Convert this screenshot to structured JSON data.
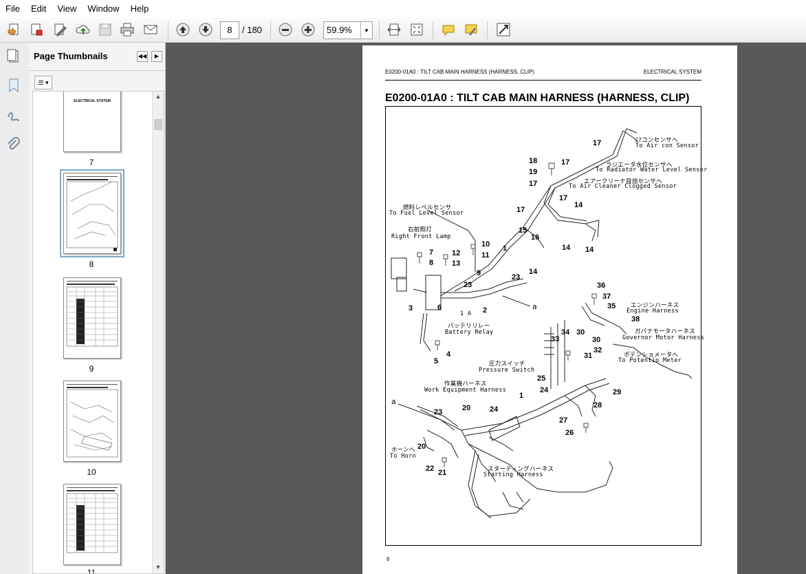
{
  "menu": [
    "File",
    "Edit",
    "View",
    "Window",
    "Help"
  ],
  "toolbar": {
    "current_page": "8",
    "page_count": "/ 180",
    "zoom": "59.9%"
  },
  "panel": {
    "title": "Page Thumbnails",
    "thumbnails": [
      {
        "page": "7",
        "header": "ELECTRICAL SYSTEM"
      },
      {
        "page": "8"
      },
      {
        "page": "9"
      },
      {
        "page": "10"
      },
      {
        "page": "11"
      }
    ]
  },
  "document": {
    "header_left": "E0200-01A0 : TILT CAB MAIN HARNESS (HARNESS, CLIP)",
    "header_right": "ELECTRICAL SYSTEM",
    "title": "E0200-01A0 : TILT CAB MAIN HARNESS (HARNESS, CLIP)",
    "page_number": "6",
    "labels": {
      "aircon_jp": "ｴｱコンセンサへ",
      "aircon_en": "To Air con Sensor",
      "radiator_jp": "ラジエータ水位センサへ",
      "radiator_en": "To Radiator Water Level Sensor",
      "aircleaner_jp": "エアークリーナ目詰センサへ",
      "aircleaner_en": "To Air Cleaner Clogged Sensor",
      "fuel_jp": "燃料レベルセンサ",
      "fuel_en": "To Fuel Level Sensor",
      "frontlamp_jp": "右前照灯",
      "frontlamp_en": "Right Front Lamp",
      "relay_jp": "バッテリリレー",
      "relay_en": "Battery Relay",
      "engine_jp": "エンジンハーネス",
      "engine_en": "Engine Harness",
      "governor_jp": "ガバナモータハーネス",
      "governor_en": "Governor Motor Harness",
      "potentio_jp": "ポテンショメータへ",
      "potentio_en": "To Potentio Meter",
      "pressure_jp": "圧力スイッチ",
      "pressure_en": "Pressure Switch",
      "workeq_jp": "作業機ハーネス",
      "workeq_en": "Work Equipment Harness",
      "horn_jp": "ホーンへ",
      "horn_en": "To Horn",
      "starting_jp": "スターティングハーネス",
      "starting_en": "Starting Harness",
      "one_a": "1 A",
      "a_top": "a",
      "a_left": "a"
    },
    "callouts": [
      "17",
      "17",
      "18",
      "19",
      "17",
      "17",
      "17",
      "14",
      "15",
      "16",
      "14",
      "14",
      "10",
      "11",
      "1",
      "7",
      "8",
      "12",
      "13",
      "9",
      "23",
      "23",
      "14",
      "3",
      "6",
      "2",
      "4",
      "5",
      "36",
      "37",
      "35",
      "38",
      "34",
      "30",
      "33",
      "30",
      "32",
      "31",
      "25",
      "24",
      "29",
      "28",
      "1",
      "20",
      "23",
      "24",
      "27",
      "26",
      "20",
      "22",
      "21"
    ]
  }
}
